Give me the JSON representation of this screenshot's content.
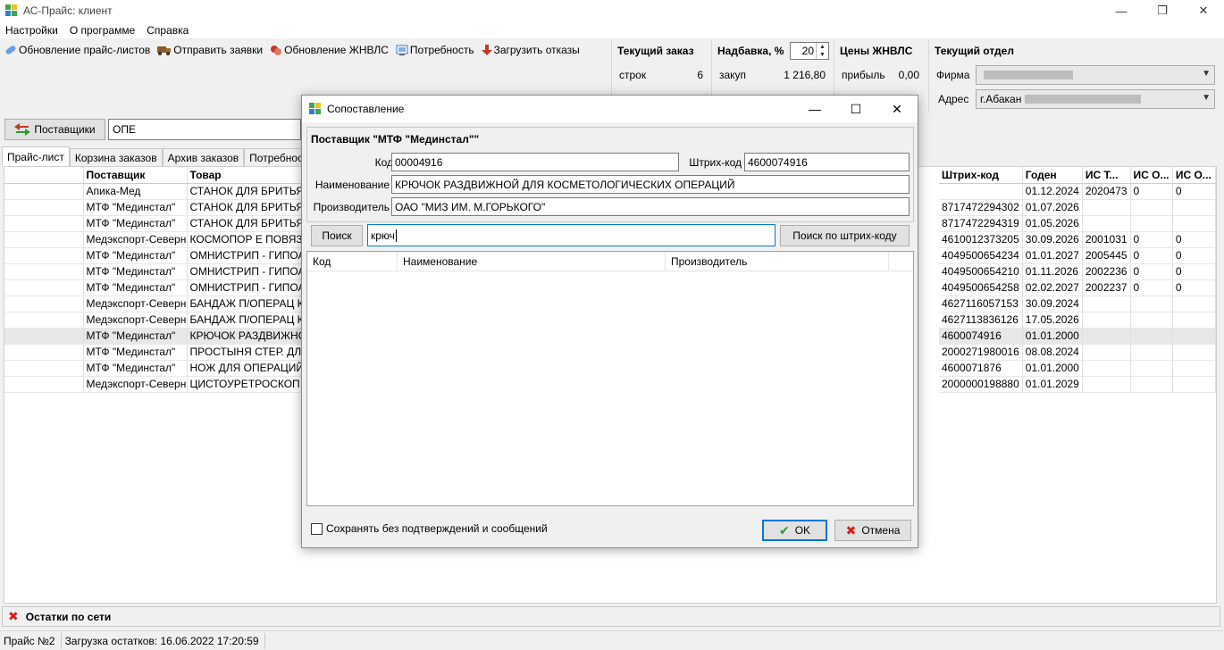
{
  "window": {
    "title": "АС-Прайс: клиент"
  },
  "menu": [
    "Настройки",
    "О программе",
    "Справка"
  ],
  "toolbar": {
    "update_prices": "Обновление прайс-листов",
    "send_orders": "Отправить заявки",
    "update_zhnvls": "Обновление ЖНВЛС",
    "need": "Потребность",
    "load_refusals": "Загрузить отказы"
  },
  "current_order": {
    "title": "Текущий заказ",
    "rows_label": "строк",
    "rows_value": "6"
  },
  "markup": {
    "title": "Надбавка, %",
    "value": "20",
    "purchase_label": "закуп",
    "purchase_value": "1 216,80"
  },
  "zhnvls_prices": {
    "title": "Цены ЖНВЛС",
    "profit_label": "прибыль",
    "profit_value": "0,00"
  },
  "department": {
    "title": "Текущий отдел",
    "firm_label": "Фирма",
    "address_label": "Адрес",
    "address_value": "г.Абакан"
  },
  "suppliers_button": "Поставщики",
  "filter_value": "ОПЕ",
  "tabs": [
    "Прайс-лист",
    "Корзина заказов",
    "Архив заказов",
    "Потребност"
  ],
  "table": {
    "columns": [
      "Поставщик",
      "Товар",
      "Штрих-код",
      "Годен",
      "ИС Т...",
      "ИС О...",
      "ИС О..."
    ],
    "rows": [
      [
        "Апика-Мед",
        "СТАНОК ДЛЯ БРИТЬЯ",
        "",
        "01.12.2024",
        "2020473",
        "0",
        "0"
      ],
      [
        "МТФ \"Мединстал\"",
        "СТАНОК ДЛЯ БРИТЬЯ",
        "8717472294302",
        "01.07.2026",
        "",
        "",
        ""
      ],
      [
        "МТФ \"Мединстал\"",
        "СТАНОК ДЛЯ БРИТЬЯ",
        "8717472294319",
        "01.05.2026",
        "",
        "",
        ""
      ],
      [
        "Медэкспорт-Северн",
        "КОСМОПОР Е ПОВЯЗК",
        "4610012373205",
        "30.09.2026",
        "2001031",
        "0",
        "0"
      ],
      [
        "МТФ \"Мединстал\"",
        "ОМНИСТРИП - ГИПОА",
        "4049500654234",
        "01.01.2027",
        "2005445",
        "0",
        "0"
      ],
      [
        "МТФ \"Мединстал\"",
        "ОМНИСТРИП - ГИПОА",
        "4049500654210",
        "01.11.2026",
        "2002236",
        "0",
        "0"
      ],
      [
        "МТФ \"Мединстал\"",
        "ОМНИСТРИП - ГИПОА",
        "4049500654258",
        "02.02.2027",
        "2002237",
        "0",
        "0"
      ],
      [
        "Медэкспорт-Северн",
        "БАНДАЖ П/ОПЕРАЦ К",
        "4627116057153",
        "30.09.2024",
        "",
        "",
        ""
      ],
      [
        "Медэкспорт-Северн",
        "БАНДАЖ П/ОПЕРАЦ К",
        "4627113836126",
        "17.05.2026",
        "",
        "",
        ""
      ],
      [
        "МТФ \"Мединстал\"",
        "КРЮЧОК РАЗДВИЖНО",
        "4600074916",
        "01.01.2000",
        "",
        "",
        ""
      ],
      [
        "МТФ \"Мединстал\"",
        "ПРОСТЫНЯ СТЕР. ДЛЯ",
        "2000271980016",
        "08.08.2024",
        "",
        "",
        ""
      ],
      [
        "МТФ \"Мединстал\"",
        "НОЖ ДЛЯ ОПЕРАЦИЙ",
        "4600071876",
        "01.01.2000",
        "",
        "",
        ""
      ],
      [
        "Медэкспорт-Северн",
        "ЦИСТОУРЕТРОСКОП С",
        "2000000198880",
        "01.01.2029",
        "",
        "",
        ""
      ]
    ],
    "selected_row": 9
  },
  "bottom_panel": "Остатки по сети",
  "status": {
    "price_no": "Прайс №2",
    "load_info": "Загрузка остатков: 16.06.2022 17:20:59"
  },
  "dialog": {
    "title": "Сопоставление",
    "supplier": "Поставщик \"МТФ \"Мединстал\"\"",
    "code_label": "Код",
    "code_value": "00004916",
    "barcode_label": "Штрих-код",
    "barcode_value": "4600074916",
    "name_label": "Наименование",
    "name_value": "КРЮЧОК РАЗДВИЖНОЙ ДЛЯ КОСМЕТОЛОГИЧЕСКИХ ОПЕРАЦИЙ",
    "maker_label": "Производитель",
    "maker_value": "ОАО \"МИЗ ИМ. М.ГОРЬКОГО\"",
    "search_button": "Поиск",
    "search_value": "крюч",
    "barcode_search_button": "Поиск по штрих-коду",
    "result_columns": [
      "Код",
      "Наименование",
      "Производитель"
    ],
    "checkbox_label": "Сохранять без подтверждений и сообщений",
    "ok": "OK",
    "cancel": "Отмена"
  },
  "colors": {
    "accent": "#0078d7",
    "selection": "#e8e8e8",
    "ok_green": "#2e9a2e",
    "cancel_red": "#d32020"
  }
}
